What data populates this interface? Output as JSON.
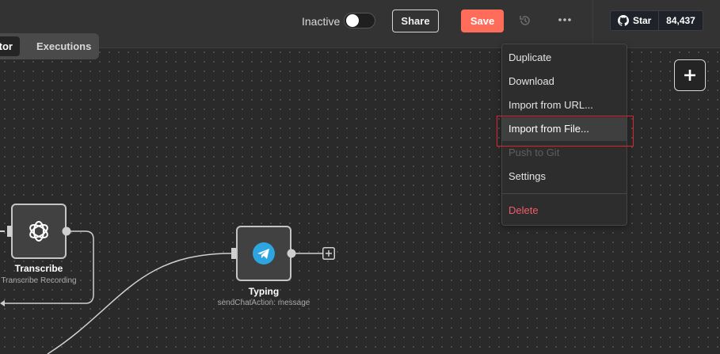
{
  "header": {
    "active_label": "Inactive",
    "share_label": "Share",
    "save_label": "Save",
    "github": {
      "star_label": "Star",
      "star_count": "84,437"
    }
  },
  "tabs": {
    "editor_label": "Editor",
    "executions_label": "Executions"
  },
  "menu": {
    "items": [
      {
        "label": "Duplicate",
        "state": "normal"
      },
      {
        "label": "Download",
        "state": "normal"
      },
      {
        "label": "Import from URL...",
        "state": "normal"
      },
      {
        "label": "Import from File...",
        "state": "hover"
      },
      {
        "label": "Push to Git",
        "state": "disabled"
      },
      {
        "label": "Settings",
        "state": "normal"
      },
      {
        "label": "Delete",
        "state": "danger"
      }
    ]
  },
  "nodes": {
    "transcribe": {
      "title": "Transcribe",
      "subtitle": "Transcribe Recording",
      "icon": "openai-icon"
    },
    "typing": {
      "title": "Typing",
      "subtitle": "sendChatAction: message",
      "icon": "telegram-icon"
    }
  },
  "colors": {
    "save": "#ff6d5a",
    "delete": "#f35b6a",
    "telegram": "#2ca5e0",
    "highlight": "#d9252b"
  }
}
